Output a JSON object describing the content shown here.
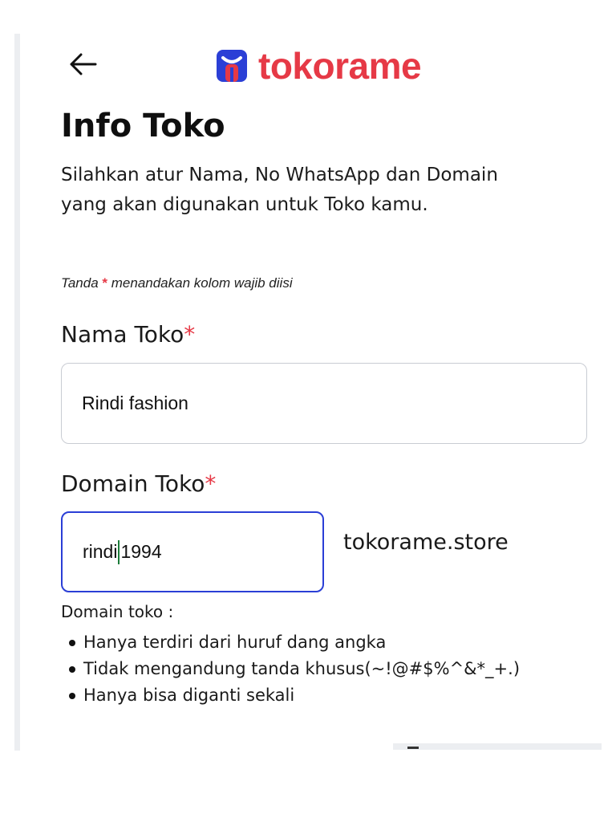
{
  "header": {
    "back_icon": "arrow-left-icon",
    "logo_icon": "bag-logo-icon",
    "logo_text": "tokorame",
    "brand_color": "#e63946",
    "logo_icon_color": "#2b3fd6"
  },
  "page": {
    "title": "Info Toko",
    "description": "Silahkan atur Nama, No WhatsApp dan Domain yang akan digunakan untuk Toko kamu.",
    "required_note_prefix": "Tanda",
    "required_star": "*",
    "required_note_suffix": "menandakan kolom wajib diisi"
  },
  "form": {
    "store_name": {
      "label": "Nama Toko",
      "required_mark": "*",
      "value": "Rindi fashion"
    },
    "store_domain": {
      "label": "Domain Toko",
      "required_mark": "*",
      "value_before_cursor": "rindi",
      "value_after_cursor": "1994",
      "suffix": "tokorame.store",
      "focus_color": "#2b3fd6"
    },
    "domain_hint": {
      "title": "Domain toko :",
      "rules": [
        "Hanya terdiri dari huruf dang angka",
        "Tidak mengandung tanda khusus(~!@#$%^&*_+.)",
        "Hanya bisa diganti sekali"
      ]
    }
  }
}
